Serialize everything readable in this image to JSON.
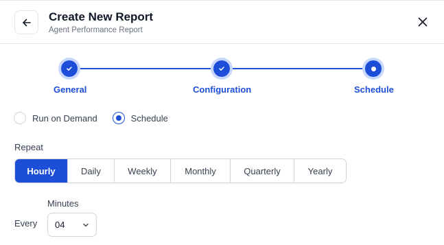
{
  "header": {
    "title": "Create New Report",
    "subtitle": "Agent Performance Report",
    "back_icon": "arrow-left-icon",
    "close_icon": "close-icon"
  },
  "stepper": {
    "steps": [
      {
        "label": "General",
        "state": "completed"
      },
      {
        "label": "Configuration",
        "state": "completed"
      },
      {
        "label": "Schedule",
        "state": "current"
      }
    ]
  },
  "run_mode": {
    "options": [
      {
        "label": "Run on Demand",
        "selected": false
      },
      {
        "label": "Schedule",
        "selected": true
      }
    ]
  },
  "repeat": {
    "label": "Repeat",
    "options": [
      "Hourly",
      "Daily",
      "Weekly",
      "Monthly",
      "Quarterly",
      "Yearly"
    ],
    "selected": "Hourly"
  },
  "minutes": {
    "label": "Minutes",
    "every_label": "Every",
    "value": "04"
  },
  "colors": {
    "accent": "#1d4ed8",
    "accent_ring": "#c7d7fb",
    "border": "#d1d5db"
  }
}
